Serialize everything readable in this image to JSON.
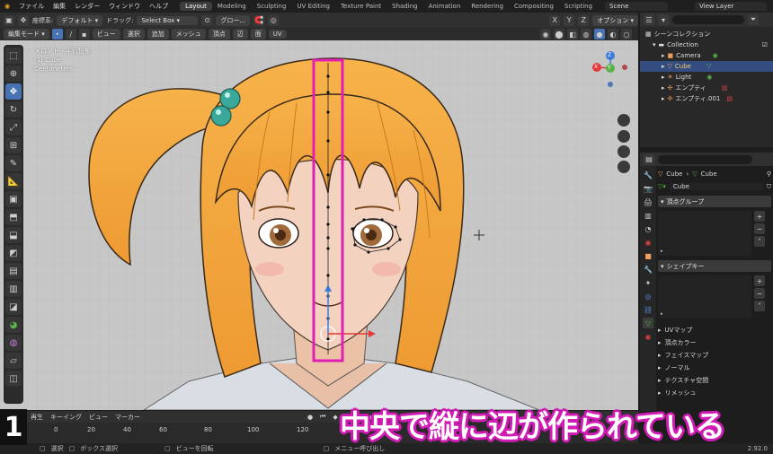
{
  "topbar": {
    "menus": [
      "ファイル",
      "編集",
      "レンダー",
      "ウィンドウ",
      "ヘルプ"
    ],
    "workspaces": [
      "Layout",
      "Modeling",
      "Sculpting",
      "UV Editing",
      "Texture Paint",
      "Shading",
      "Animation",
      "Rendering",
      "Compositing",
      "Scripting"
    ],
    "active_workspace": "Layout",
    "scene": "Scene",
    "view_layer": "View Layer"
  },
  "header": {
    "coord_label": "座標系:",
    "coord_value": "デフォルト",
    "drag_label": "ドラッグ:",
    "drag_value": "Select Box",
    "pivot_value": "グロー...",
    "options_label": "オプション",
    "axes": [
      "X",
      "Y",
      "Z"
    ]
  },
  "header2": {
    "mode": "編集モード",
    "menus": [
      "ビュー",
      "選択",
      "追加",
      "メッシュ",
      "頂点",
      "辺",
      "面",
      "UV"
    ]
  },
  "viewport": {
    "info_line1": "メロソト・平行投影",
    "info_line2": "(1) Cube",
    "info_line3": "Centimeters",
    "gizmo_labels": [
      "X",
      "Y",
      "Z"
    ]
  },
  "outliner": {
    "title": "シーンコレクション",
    "items": [
      {
        "name": "Collection",
        "level": 0
      },
      {
        "name": "Camera",
        "level": 1
      },
      {
        "name": "Cube",
        "level": 1,
        "selected": true
      },
      {
        "name": "Light",
        "level": 1
      },
      {
        "name": "エンプティ",
        "level": 1
      },
      {
        "name": "エンプティ.001",
        "level": 1
      }
    ]
  },
  "properties": {
    "object_name": "Cube",
    "mesh_name": "Cube",
    "data_field": "Cube",
    "panels": [
      "頂点グループ",
      "シェイプキー"
    ],
    "collapsed": [
      "UVマップ",
      "頂点カラー",
      "フェイスマップ",
      "ノーマル",
      "テクスチャ空間",
      "リメッシュ"
    ]
  },
  "timeline": {
    "menus": [
      "再生",
      "キーイング",
      "ビュー",
      "マーカー"
    ],
    "ticks": [
      "0",
      "20",
      "40",
      "60",
      "80",
      "100",
      "120"
    ]
  },
  "statusbar": {
    "items": [
      "選択",
      "ボックス選択",
      "ビューを回転",
      "メニュー呼び出し"
    ],
    "version": "2.92.0"
  },
  "overlay": {
    "step": "1",
    "caption": "中央で縦に辺が作られている"
  },
  "colors": {
    "accent": "#4772b3",
    "highlight": "#e020b4",
    "hair": "#f0a23c"
  }
}
